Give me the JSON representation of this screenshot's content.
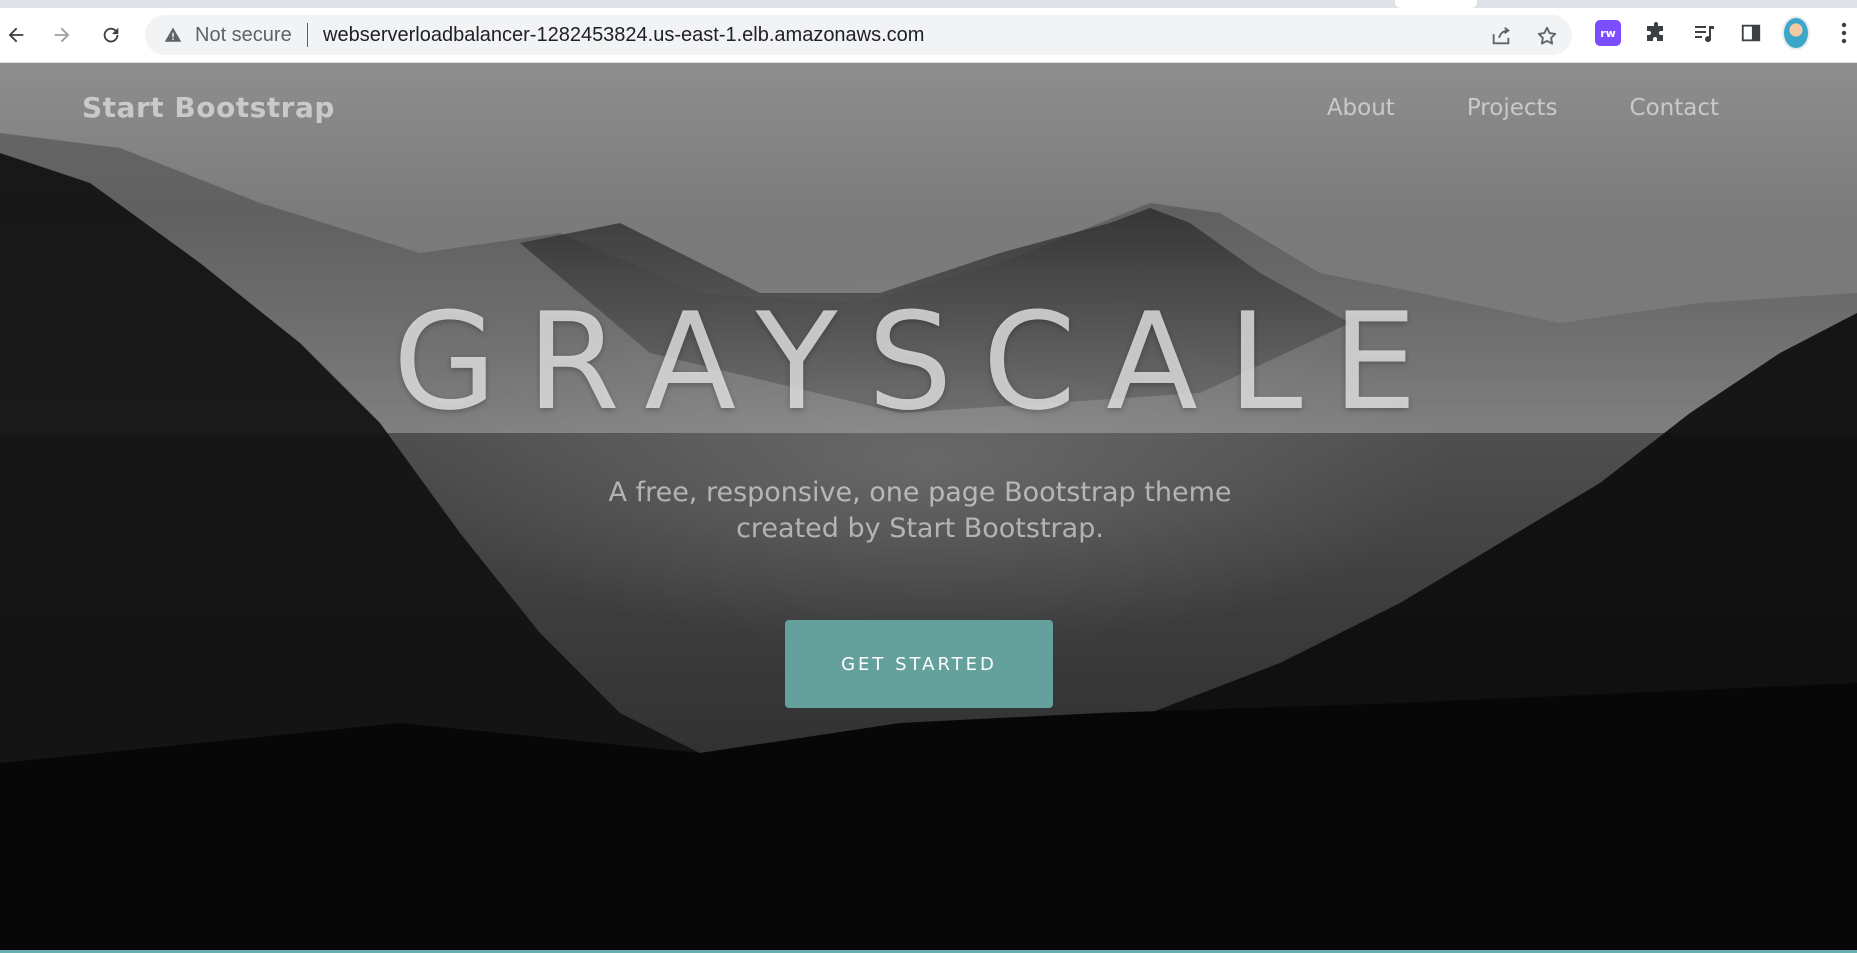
{
  "browser": {
    "security_label": "Not secure",
    "url": "webserverloadbalancer-1282453824.us-east-1.elb.amazonaws.com",
    "extension_label": "rw",
    "icons": [
      "back-arrow-icon",
      "forward-arrow-icon",
      "reload-icon",
      "warning-icon",
      "share-icon",
      "star-icon",
      "extension-rw-icon",
      "puzzle-icon",
      "media-queue-icon",
      "side-panel-icon",
      "avatar",
      "more-menu-icon"
    ]
  },
  "navbar": {
    "brand": "Start Bootstrap",
    "links": [
      "About",
      "Projects",
      "Contact"
    ]
  },
  "hero": {
    "title": "GRAYSCALE",
    "subtitle_line1": "A free, responsive, one page Bootstrap theme",
    "subtitle_line2": "created by Start Bootstrap.",
    "button_label": "GET STARTED"
  },
  "colors": {
    "accent": "#64a19d",
    "chrome_bg": "#ffffff",
    "omnibox_bg": "#f1f3f4",
    "extension_purple": "#7c4dff"
  }
}
